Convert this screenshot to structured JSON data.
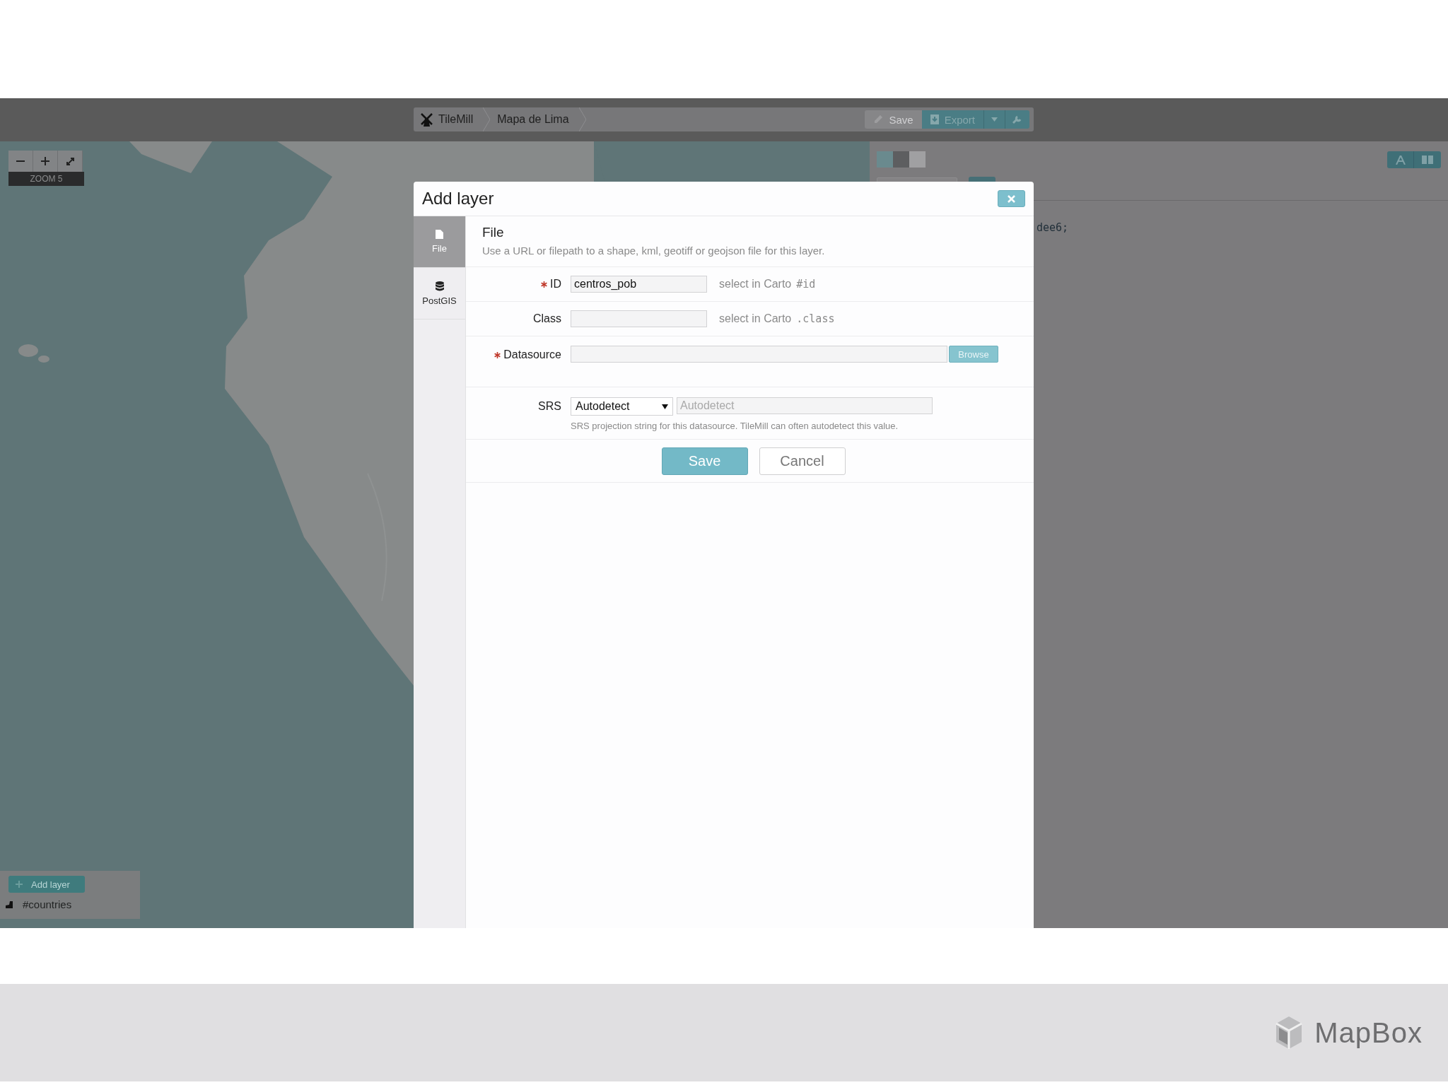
{
  "toolbar": {
    "breadcrumbs": [
      "TileMill",
      "Mapa de Lima"
    ],
    "save_label": "Save",
    "save_disabled": true,
    "export_label": "Export"
  },
  "map": {
    "zoom_label": "ZOOM 5"
  },
  "layers": {
    "add_label": "Add layer",
    "items": [
      {
        "name": "#countries"
      }
    ]
  },
  "editor": {
    "code_line": "dee6;"
  },
  "dialog": {
    "title": "Add layer",
    "tabs": [
      {
        "label": "File",
        "kind": "file",
        "selected": true
      },
      {
        "label": "PostGIS",
        "kind": "database",
        "selected": false
      }
    ],
    "heading": "File",
    "description": "Use a URL or filepath to a shape, kml, geotiff or geojson file for this layer.",
    "fields": [
      {
        "kind": "text",
        "label": "ID",
        "required": true,
        "value": "centros_pob",
        "hint": "select in Carto",
        "hint_code": "#id"
      },
      {
        "kind": "text",
        "label": "Class",
        "required": false,
        "hint": "select in Carto",
        "hint_code": ".class"
      },
      {
        "kind": "file",
        "label": "Datasource",
        "required": true,
        "button": "Browse"
      },
      {
        "kind": "srs",
        "label": "SRS",
        "required": false,
        "select_value": "Autodetect",
        "placeholder": "Autodetect",
        "help": "SRS projection string for this datasource. TileMill can often autodetect this value."
      }
    ],
    "buttons": [
      {
        "label": "Save",
        "kind": "primary"
      },
      {
        "label": "Cancel",
        "kind": "secondary"
      }
    ]
  },
  "footer": {
    "brand": "MapBox"
  }
}
